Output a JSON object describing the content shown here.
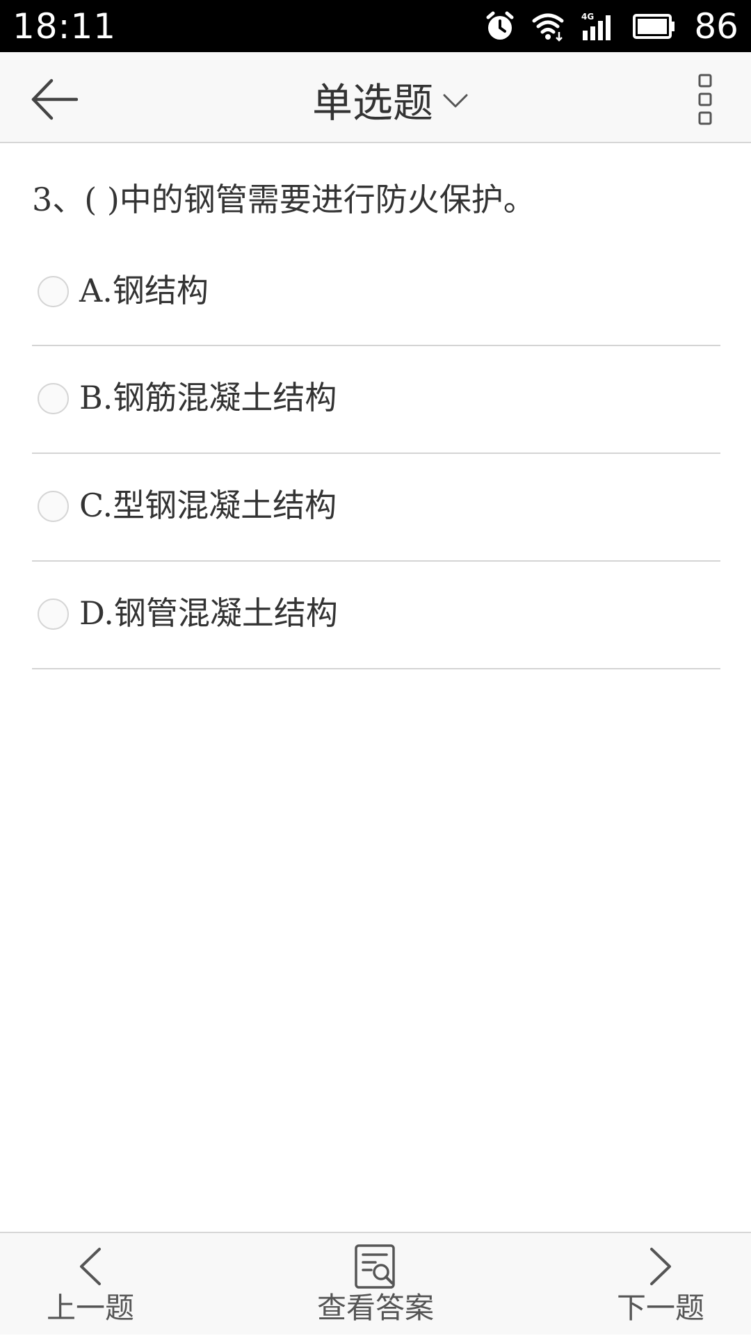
{
  "status_bar": {
    "time": "18:11",
    "network": "4G",
    "battery": "86"
  },
  "app_bar": {
    "title": "单选题"
  },
  "question": {
    "text": "3、( )中的钢管需要进行防火保护。",
    "options": [
      {
        "label": "A.钢结构",
        "selected": false
      },
      {
        "label": "B.钢筋混凝土结构",
        "selected": false
      },
      {
        "label": "C.型钢混凝土结构",
        "selected": false
      },
      {
        "label": "D.钢管混凝土结构",
        "selected": false
      }
    ]
  },
  "bottom_bar": {
    "prev_label": "上一题",
    "answer_label": "查看答案",
    "next_label": "下一题"
  },
  "colors": {
    "status_bar_bg": "#000000",
    "bar_bg": "#f8f8f8",
    "text": "#333333",
    "divider": "#d4d4d4"
  }
}
